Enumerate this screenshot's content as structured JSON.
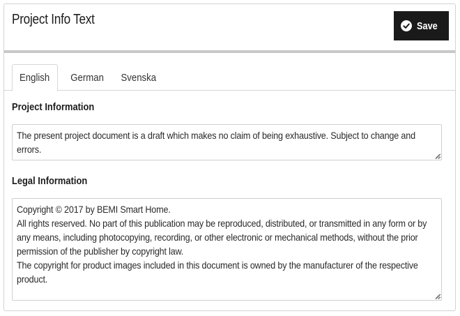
{
  "header": {
    "title": "Project Info Text",
    "save_label": "Save",
    "save_icon": "check-circle-icon"
  },
  "tabs": [
    {
      "label": "English",
      "active": true
    },
    {
      "label": "German",
      "active": false
    },
    {
      "label": "Svenska",
      "active": false
    }
  ],
  "fields": {
    "project_info": {
      "label": "Project Information",
      "value": "The present project document is a draft which makes no claim of being exhaustive. Subject to change and errors."
    },
    "legal_info": {
      "label": "Legal Information",
      "value": "Copyright © 2017 by BEMI Smart Home.\nAll rights reserved. No part of this publication may be reproduced, distributed, or transmitted in any form or by any means, including photocopying, recording, or other electronic or mechanical methods, without the prior permission of the publisher by copyright law.\nThe copyright for product images included in this document is owned by the manufacturer of the respective product."
    }
  },
  "colors": {
    "button_bg": "#1a1a1a",
    "header_rule": "#c8c8c8",
    "border": "#d3d3d3"
  }
}
